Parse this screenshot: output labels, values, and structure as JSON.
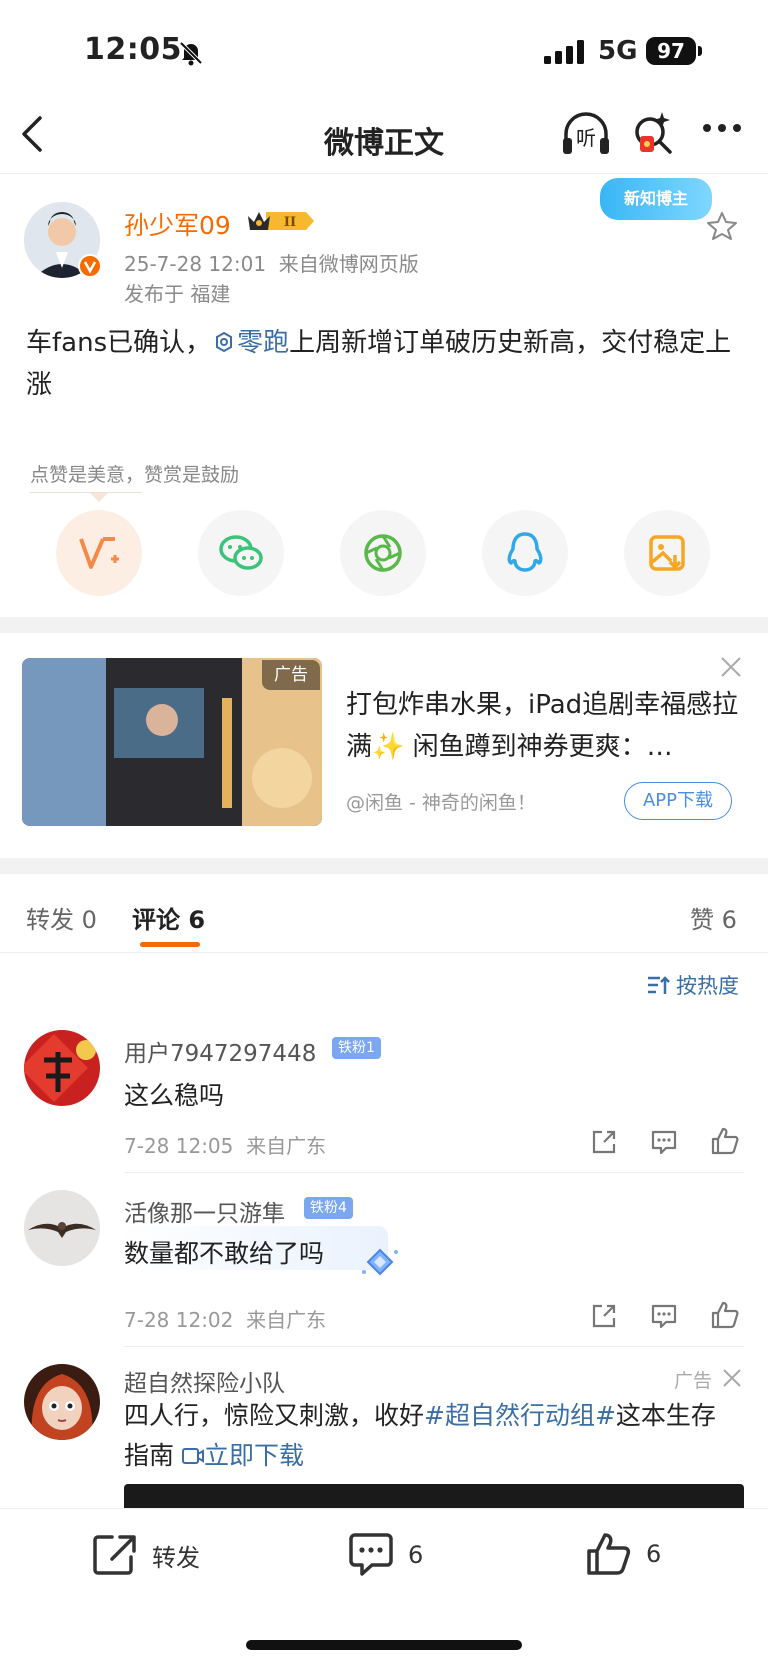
{
  "status_bar": {
    "time": "12:05",
    "network": "5G",
    "battery": "97"
  },
  "nav": {
    "title": "微博正文",
    "listen_label": "听"
  },
  "post": {
    "author": "孙少军09",
    "level_badge": "II",
    "new_badge": "新知博主",
    "timestamp": "25-7-28 12:01",
    "source": "来自微博网页版",
    "location": "发布于 福建",
    "text_prefix": "车fans已确认，",
    "topic": "零跑",
    "text_suffix": "上周新增订单破历史新高，交付稳定上涨",
    "reward_hint": "点赞是美意，赞赏是鼓励"
  },
  "ad": {
    "badge": "广告",
    "title": "打包炸串水果，iPad追剧幸福感拉满✨ 闲鱼蹲到神券更爽：…",
    "source": "@闲鱼 - 神奇的闲鱼！",
    "cta": "APP下载"
  },
  "tabs": {
    "repost_label": "转发",
    "repost_count": "0",
    "comment_label": "评论",
    "comment_count": "6",
    "like_label": "赞",
    "like_count": "6",
    "sort_label": "按热度"
  },
  "comments": [
    {
      "user": "用户7947297448",
      "fan_badge": "铁粉1",
      "text": "这么稳吗",
      "time": "7-28 12:05",
      "location": "来自广东"
    },
    {
      "user": "活像那一只游隼",
      "fan_badge": "铁粉4",
      "text": "数量都不敢给了吗",
      "time": "7-28 12:02",
      "location": "来自广东"
    }
  ],
  "ad_comment": {
    "user": "超自然探险小队",
    "badge": "广告",
    "text_prefix": "四人行，惊险又刺激，收好",
    "tag": "#超自然行动组#",
    "text_mid": "这本生存指南",
    "link": "立即下载"
  },
  "bottom_bar": {
    "repost": "转发",
    "comments": "6",
    "likes": "6"
  },
  "colors": {
    "accent_orange": "#f76a00",
    "link_blue": "#3a6ea5",
    "wechat_green": "#3cc37a",
    "qq_blue": "#31a8e8",
    "save_orange": "#f5a623"
  }
}
